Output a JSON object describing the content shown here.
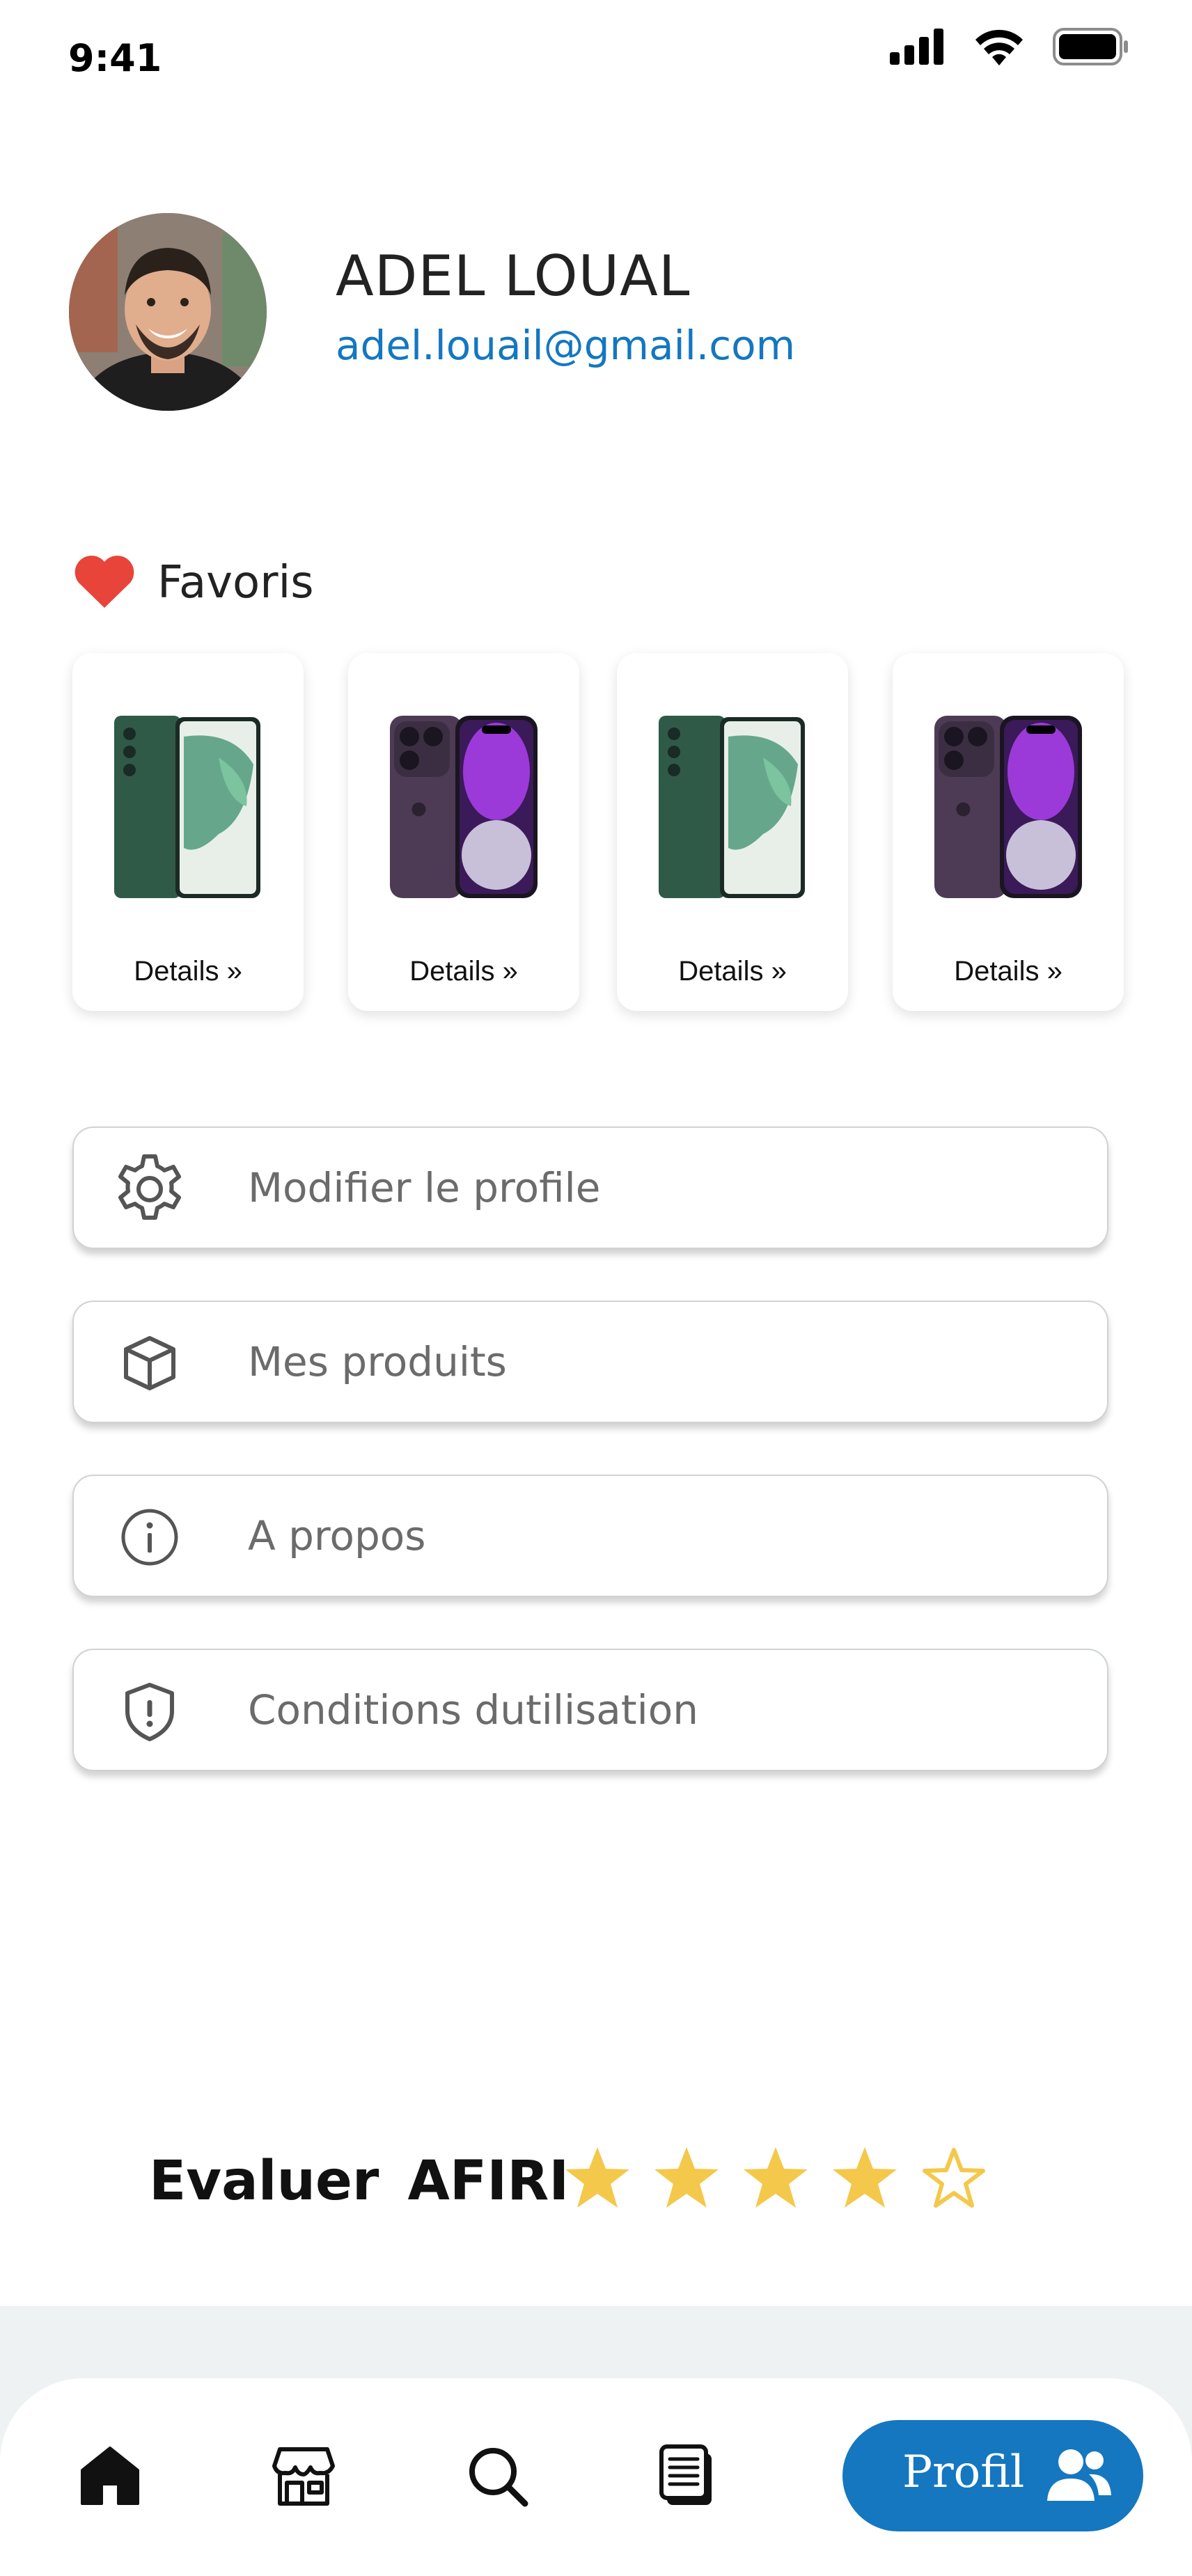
{
  "status_bar": {
    "time": "9:41",
    "icons": [
      "signal-icon",
      "wifi-icon",
      "battery-icon"
    ]
  },
  "profile": {
    "name": "ADEL LOUAL",
    "email": "adel.louail@gmail.com"
  },
  "favorites": {
    "title": "Favoris",
    "heart_color": "#e8443a",
    "items": [
      {
        "image": "samsung-galaxy-green-phone",
        "details_label": "Details"
      },
      {
        "image": "iphone-purple-phone",
        "details_label": "Details"
      },
      {
        "image": "samsung-galaxy-green-phone",
        "details_label": "Details"
      },
      {
        "image": "iphone-purple-phone",
        "details_label": "Details"
      }
    ]
  },
  "menu": [
    {
      "icon": "gear-icon",
      "label": "Modifier le profile"
    },
    {
      "icon": "box-icon",
      "label": "Mes produits"
    },
    {
      "icon": "info-icon",
      "label": "A propos"
    },
    {
      "icon": "shield-icon",
      "label": "Conditions dutilisation"
    }
  ],
  "rating": {
    "label": "Evaluer  AFIRI",
    "value": 4,
    "max": 5,
    "star_color": "#f4c84a"
  },
  "bottom_nav": {
    "items": [
      "home-icon",
      "store-icon",
      "search-icon",
      "news-icon"
    ],
    "active_label": "Profil",
    "active_icon": "users-icon",
    "accent": "#1477c0"
  }
}
